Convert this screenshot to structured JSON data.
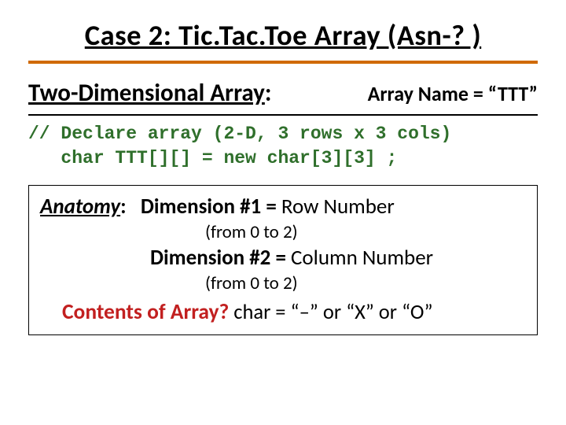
{
  "title": "Case 2: Tic.Tac.Toe Array (Asn-? )",
  "subheading": "Two-Dimensional Array",
  "subheading_colon": ":",
  "array_name": "Array Name = “TTT”",
  "code_line1": "// Declare array (2-D, 3 rows x 3 cols)",
  "code_line2": "   char TTT[][] = new char[3][3] ;",
  "anatomy": {
    "label": "Anatomy",
    "colon": ":",
    "dim1_label": "Dimension #1 = ",
    "dim1_value": "Row Number",
    "dim1_from": "(from 0 to 2)",
    "dim2_label": "Dimension #2 = ",
    "dim2_value": "Column Number",
    "dim2_from": "(from 0 to 2)",
    "contents_q": "Contents of Array?",
    "contents_a": "  char = “–” or “X” or “O”"
  }
}
